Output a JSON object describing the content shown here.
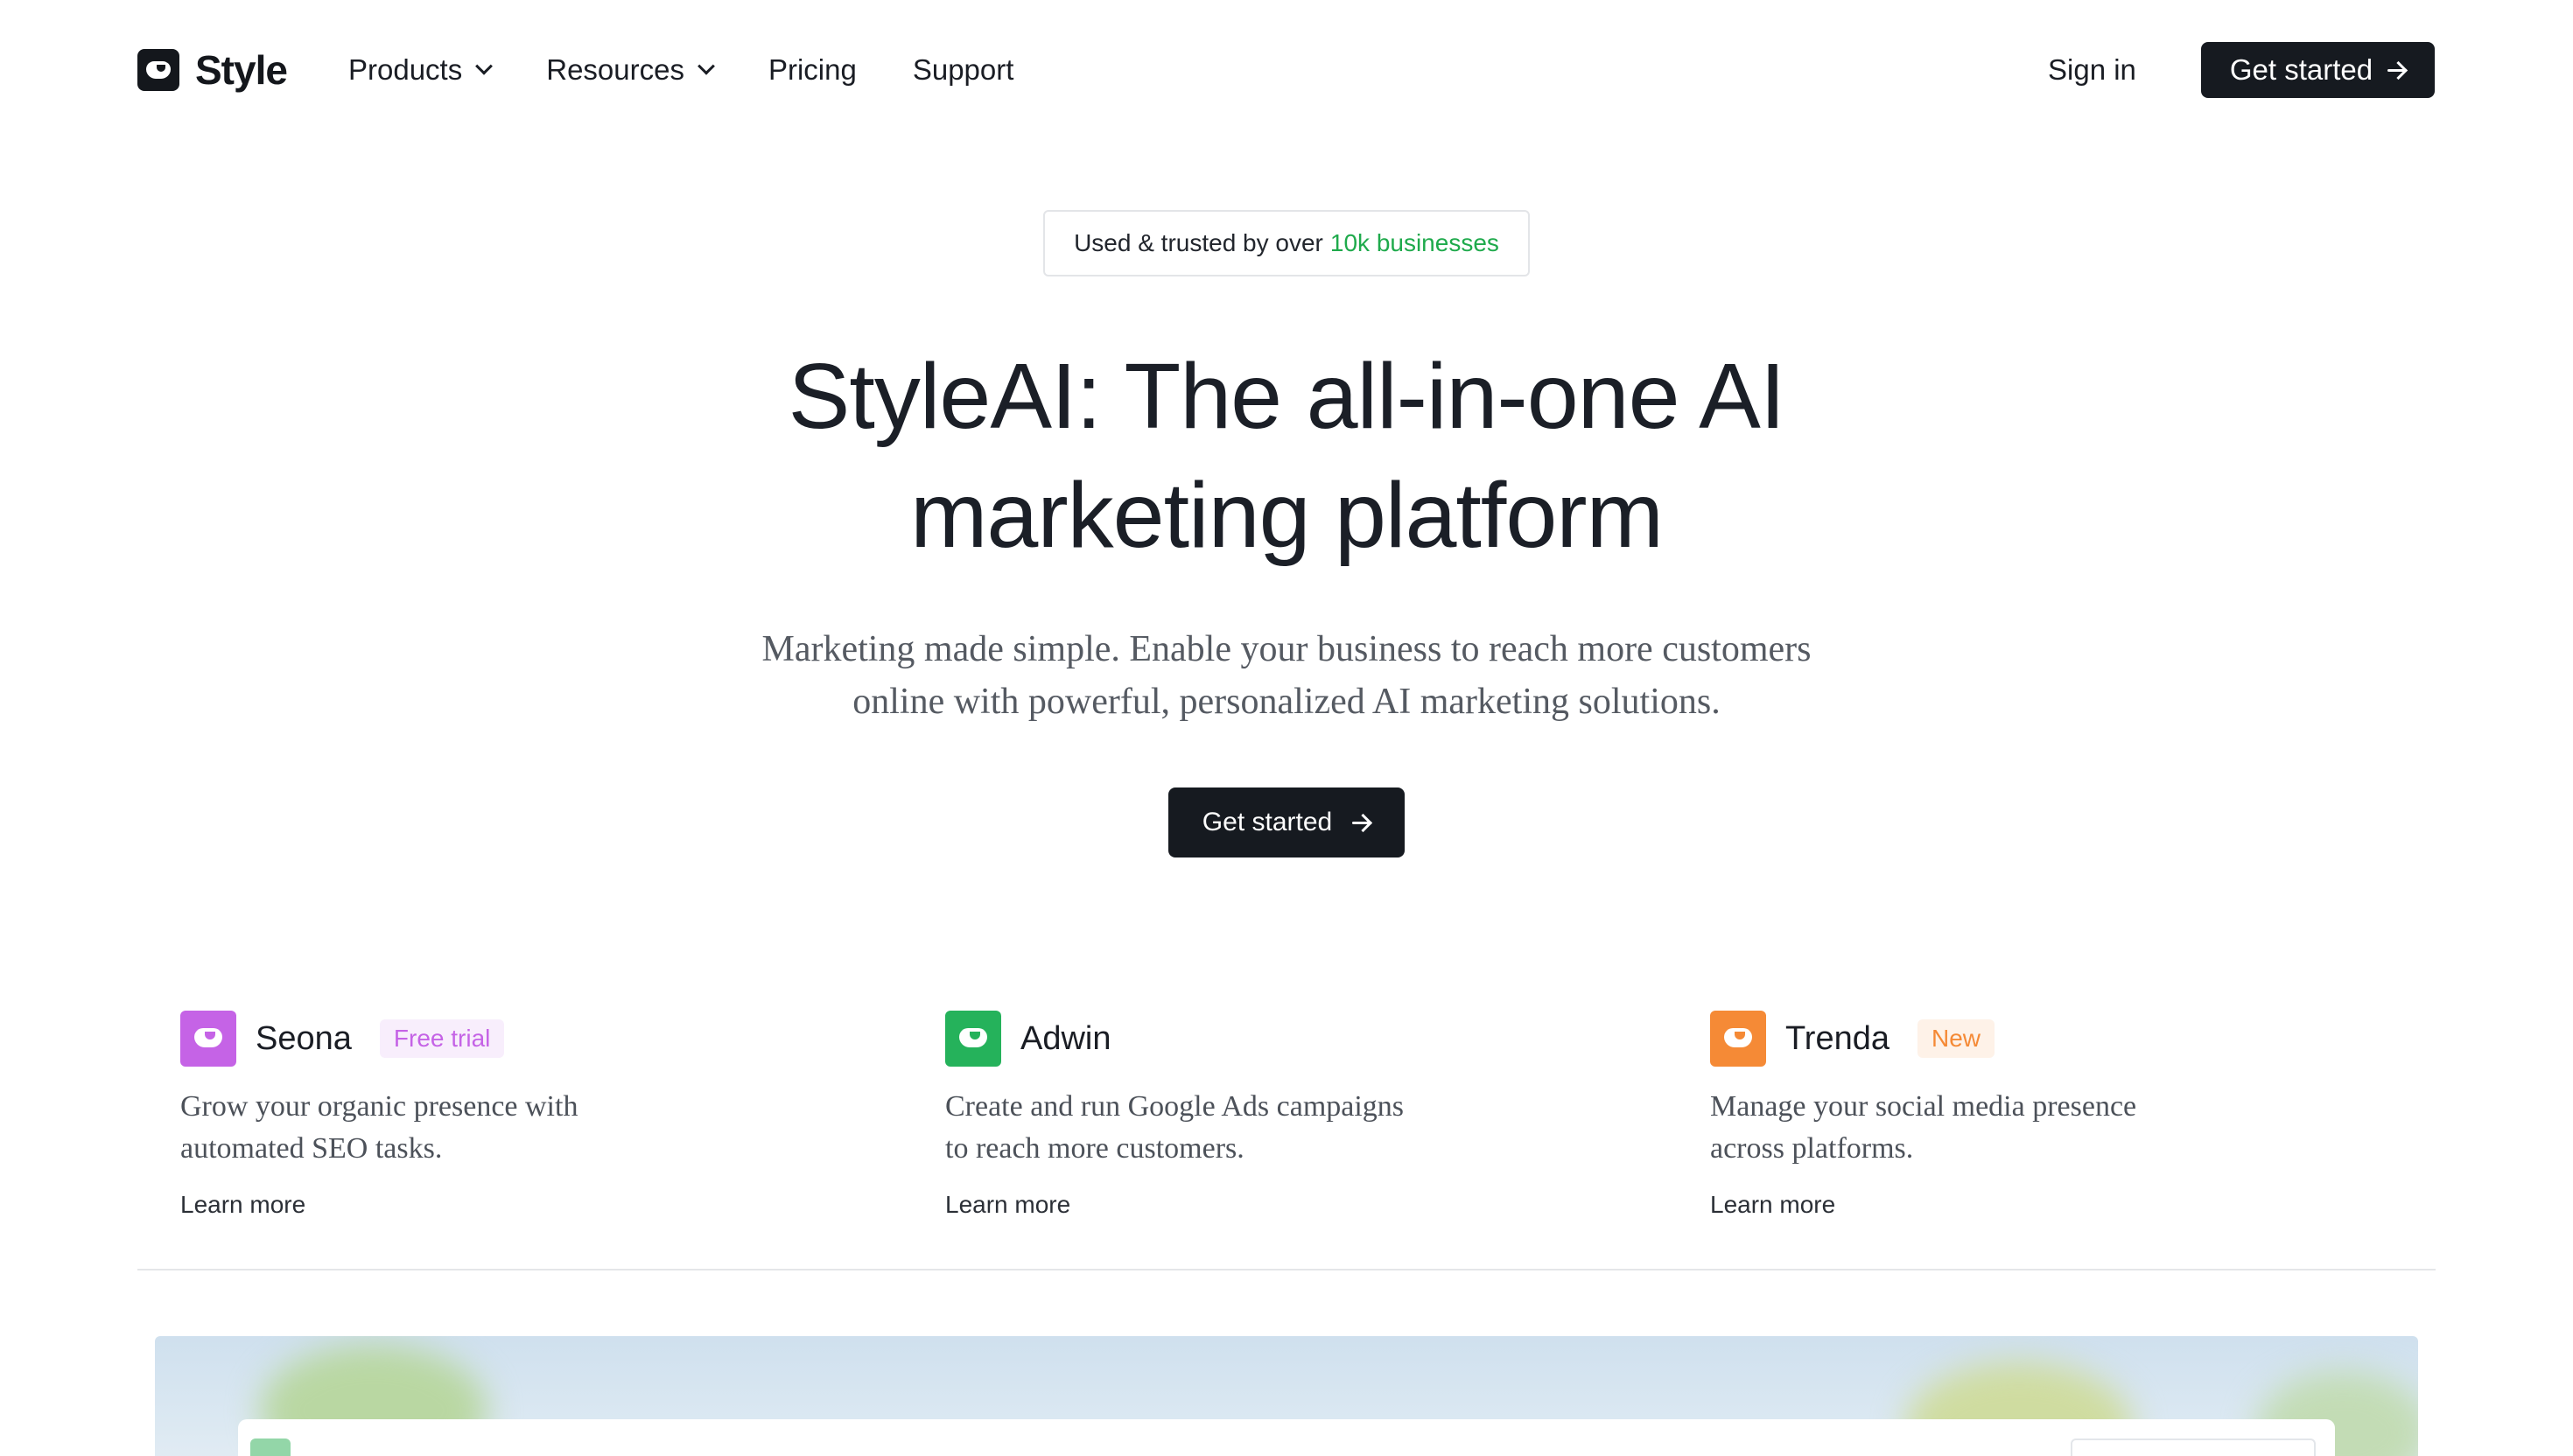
{
  "brand": {
    "name": "Style"
  },
  "nav": {
    "items": [
      {
        "label": "Products",
        "dropdown": true
      },
      {
        "label": "Resources",
        "dropdown": true
      },
      {
        "label": "Pricing",
        "dropdown": false
      },
      {
        "label": "Support",
        "dropdown": false
      }
    ],
    "signin_label": "Sign in",
    "cta_label": "Get started"
  },
  "hero": {
    "badge_prefix": "Used & trusted by over",
    "badge_highlight": "10k businesses",
    "title_line1": "StyleAI: The all-in-one AI",
    "title_line2": "marketing platform",
    "subtitle_line1": "Marketing made simple. Enable your business to reach more customers",
    "subtitle_line2": "online with powerful, personalized AI marketing solutions.",
    "cta_label": "Get started"
  },
  "products": [
    {
      "name": "Seona",
      "tag": "Free trial",
      "icon_color": "#c563e6",
      "tag_color": "#c563e6",
      "tag_bg": "#f8eefc",
      "desc_line1": "Grow your organic presence with",
      "desc_line2": "automated SEO tasks.",
      "link": "Learn more"
    },
    {
      "name": "Adwin",
      "tag": "",
      "icon_color": "#25b25b",
      "tag_color": "",
      "tag_bg": "",
      "desc_line1": "Create and run Google Ads campaigns",
      "desc_line2": "to reach more customers.",
      "link": "Learn more"
    },
    {
      "name": "Trenda",
      "tag": "New",
      "icon_color": "#f58a36",
      "tag_color": "#f58a36",
      "tag_bg": "#fef2e8",
      "desc_line1": "Manage your social media presence",
      "desc_line2": "across platforms.",
      "link": "Learn more"
    }
  ],
  "colors": {
    "primary_dark": "#161a20",
    "accent_green": "#1faa4c"
  }
}
